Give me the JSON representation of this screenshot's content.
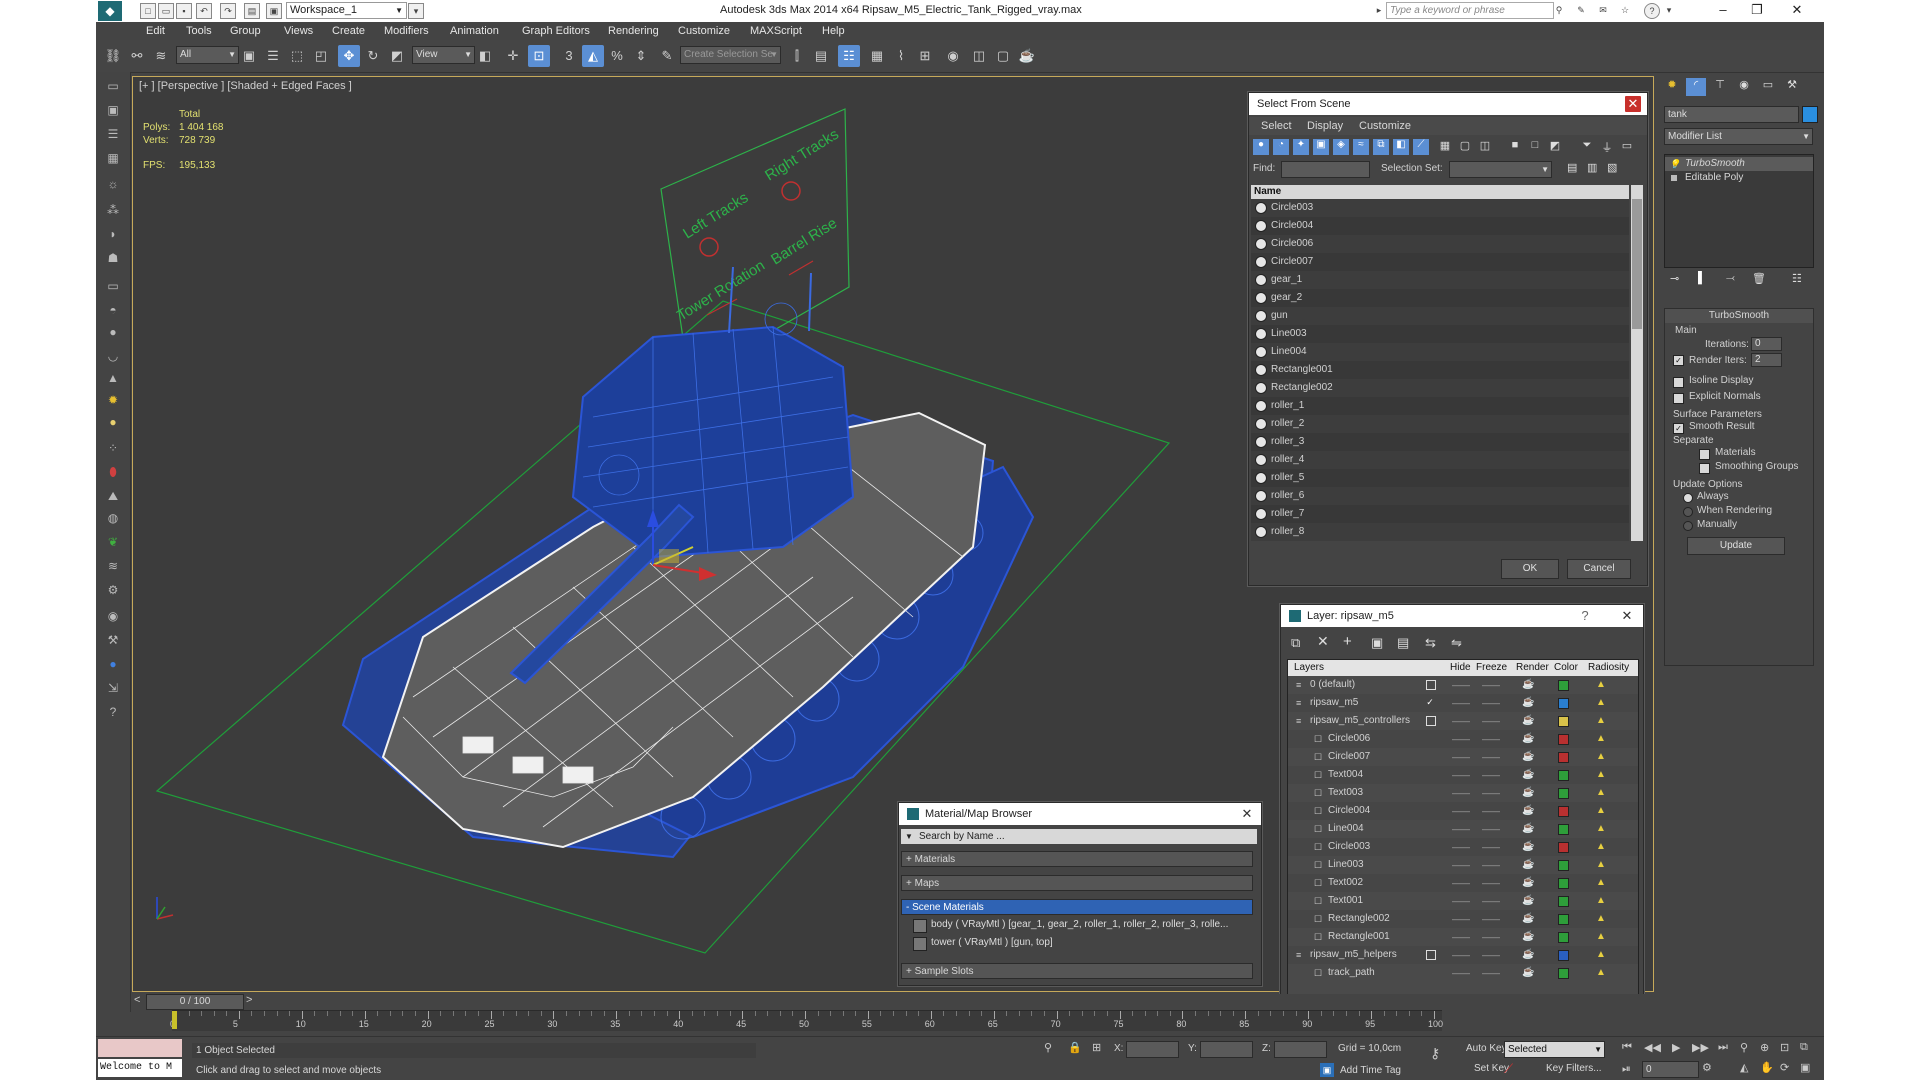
{
  "window": {
    "title": "Autodesk 3ds Max  2014 x64     Ripsaw_M5_Electric_Tank_Rigged_vray.max",
    "workspace": "Workspace_1",
    "search_placeholder": "Type a keyword or phrase"
  },
  "menu": [
    "Edit",
    "Tools",
    "Group",
    "Views",
    "Create",
    "Modifiers",
    "Animation",
    "Graph Editors",
    "Rendering",
    "Customize",
    "MAXScript",
    "Help"
  ],
  "toolbar": {
    "filter": "All",
    "ref_coord": "View",
    "snap_label": "3",
    "named_selection_placeholder": "Create Selection Se"
  },
  "viewport": {
    "label": "[+ ] [Perspective ] [Shaded + Edged Faces ]",
    "stats": {
      "header": "Total",
      "polys_label": "Polys:",
      "polys": "1 404 168",
      "verts_label": "Verts:",
      "verts": "728 739",
      "fps_label": "FPS:",
      "fps": "195,133"
    },
    "rig_labels": [
      "Left Tracks",
      "Right Tracks",
      "Tower Rotation",
      "Barrel Rise"
    ]
  },
  "select_from_scene": {
    "title": "Select From Scene",
    "menu": [
      "Select",
      "Display",
      "Customize"
    ],
    "find_label": "Find:",
    "selection_set_label": "Selection Set:",
    "column_name": "Name",
    "items": [
      "Circle003",
      "Circle004",
      "Circle006",
      "Circle007",
      "gear_1",
      "gear_2",
      "gun",
      "Line003",
      "Line004",
      "Rectangle001",
      "Rectangle002",
      "roller_1",
      "roller_2",
      "roller_3",
      "roller_4",
      "roller_5",
      "roller_6",
      "roller_7",
      "roller_8"
    ],
    "ok": "OK",
    "cancel": "Cancel"
  },
  "layer_dialog": {
    "title": "Layer: ripsaw_m5",
    "help": "?",
    "columns": [
      "Layers",
      "Hide",
      "Freeze",
      "Render",
      "Color",
      "Radiosity"
    ],
    "layers": [
      {
        "name": "0 (default)",
        "indent": 0,
        "color": "#2e9e3a"
      },
      {
        "name": "ripsaw_m5",
        "indent": 0,
        "color": "#2a7fd0",
        "active": true
      },
      {
        "name": "ripsaw_m5_controllers",
        "indent": 0,
        "color": "#d8c24a"
      },
      {
        "name": "Circle006",
        "indent": 1,
        "color": "#b83030"
      },
      {
        "name": "Circle007",
        "indent": 1,
        "color": "#b83030"
      },
      {
        "name": "Text004",
        "indent": 1,
        "color": "#2e9e3a"
      },
      {
        "name": "Text003",
        "indent": 1,
        "color": "#2e9e3a"
      },
      {
        "name": "Circle004",
        "indent": 1,
        "color": "#b83030"
      },
      {
        "name": "Line004",
        "indent": 1,
        "color": "#2e9e3a"
      },
      {
        "name": "Circle003",
        "indent": 1,
        "color": "#b83030"
      },
      {
        "name": "Line003",
        "indent": 1,
        "color": "#2e9e3a"
      },
      {
        "name": "Text002",
        "indent": 1,
        "color": "#2e9e3a"
      },
      {
        "name": "Text001",
        "indent": 1,
        "color": "#2e9e3a"
      },
      {
        "name": "Rectangle002",
        "indent": 1,
        "color": "#2e9e3a"
      },
      {
        "name": "Rectangle001",
        "indent": 1,
        "color": "#2e9e3a"
      },
      {
        "name": "ripsaw_m5_helpers",
        "indent": 0,
        "color": "#2a5fc0"
      },
      {
        "name": "track_path",
        "indent": 1,
        "color": "#2e9e3a"
      }
    ]
  },
  "material_browser": {
    "title": "Material/Map Browser",
    "search_placeholder": "Search by Name ...",
    "groups": [
      "+ Materials",
      "+ Maps",
      "- Scene Materials",
      "+ Sample Slots"
    ],
    "scene_materials": [
      "body  ( VRayMtl ) [gear_1, gear_2, roller_1, roller_2, roller_3, rolle...",
      "tower  ( VRayMtl ) [gun, top]"
    ]
  },
  "command_panel": {
    "object_name": "tank",
    "modifier_list": "Modifier List",
    "stack": [
      "TurboSmooth",
      "Editable Poly"
    ],
    "rollout_title": "TurboSmooth",
    "main_label": "Main",
    "iterations_label": "Iterations:",
    "iterations": "0",
    "render_iters_label": "Render Iters:",
    "render_iters": "2",
    "isoline": "Isoline Display",
    "explicit_normals": "Explicit Normals",
    "surface_params": "Surface Parameters",
    "smooth_result": "Smooth Result",
    "separate": "Separate",
    "materials": "Materials",
    "smoothing_groups": "Smoothing Groups",
    "update_options": "Update Options",
    "always": "Always",
    "when_rendering": "When Rendering",
    "manually": "Manually",
    "update_button": "Update"
  },
  "timeline": {
    "frame": "0 / 100",
    "ticks": [
      "0",
      "5",
      "10",
      "15",
      "20",
      "25",
      "30",
      "35",
      "40",
      "45",
      "50",
      "55",
      "60",
      "65",
      "70",
      "75",
      "80",
      "85",
      "90",
      "95",
      "100"
    ]
  },
  "status": {
    "listener": "Welcome to M",
    "selected": "1 Object Selected",
    "prompt": "Click and drag to select and move objects",
    "x_label": "X:",
    "y_label": "Y:",
    "z_label": "Z:",
    "grid": "Grid = 10,0cm",
    "add_time_tag": "Add Time Tag",
    "auto_key": "Auto Key",
    "set_key": "Set Key",
    "key_mode": "Selected",
    "key_filters": "Key Filters...",
    "frame_value": "0"
  },
  "colors": {
    "accent": "#5b8fd4",
    "wire_blue": "#2b55d6",
    "wire_white": "#f2f2f2",
    "rig_green": "#2db24a",
    "rig_red": "#d03030"
  }
}
